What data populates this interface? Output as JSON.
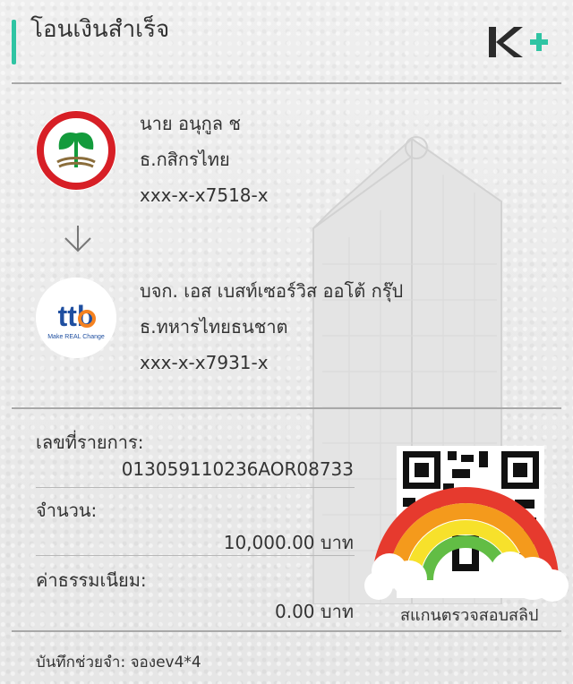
{
  "header": {
    "title": "โอนเงินสำเร็จ",
    "brand_logo": "K+"
  },
  "sender": {
    "name": "นาย อนุกูล ช",
    "bank": "ธ.กสิกรไทย",
    "account": "xxx-x-x7518-x"
  },
  "receiver": {
    "name": "บจก. เอส เบสท์เซอร์วิส ออโต้ กรุ๊ป",
    "bank": "ธ.ทหารไทยธนชาต",
    "account": "xxx-x-x7931-x",
    "logo_text": "ttb",
    "logo_tagline": "Make REAL Change"
  },
  "transaction": {
    "ref_label": "เลขที่รายการ:",
    "ref_value": "013059110236AOR08733",
    "amount_label": "จำนวน:",
    "amount_value": "10,000.00 บาท",
    "fee_label": "ค่าธรรมเนียม:",
    "fee_value": "0.00 บาท"
  },
  "memo": "บันทึกช่วยจำ: จองev4*4",
  "qr": {
    "caption": "สแกนตรวจสอบสลิป"
  },
  "colors": {
    "accent": "#2fc4a3",
    "kbank_green": "#139b3c",
    "kbank_red": "#d71f26",
    "ttb_blue": "#1f4fa0",
    "ttb_orange": "#f58220"
  },
  "icons": [
    "kbank-logo-icon",
    "down-arrow-icon",
    "ttb-logo-icon",
    "qr-code-icon",
    "rainbow-sticker-icon",
    "building-watermark-icon"
  ]
}
